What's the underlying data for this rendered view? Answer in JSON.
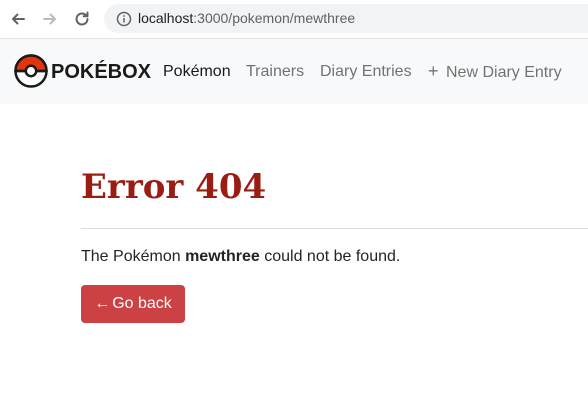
{
  "browser": {
    "url_host": "localhost",
    "url_path": ":3000/pokemon/mewthree"
  },
  "navbar": {
    "brand": "POKÉBOX",
    "links": [
      "Pokémon",
      "Trainers",
      "Diary Entries"
    ],
    "new_entry_label": "New Diary Entry",
    "new_entry_icon": "plus-icon"
  },
  "error": {
    "title": "Error 404",
    "message_prefix": "The Pokémon",
    "pokemon_name": "mewthree",
    "message_suffix": "could not be found.",
    "back_arrow": "←",
    "back_label": "Go back"
  },
  "colors": {
    "title": "#9b1c13",
    "button": "#cc4143",
    "pokeball_red": "#e3350d"
  }
}
